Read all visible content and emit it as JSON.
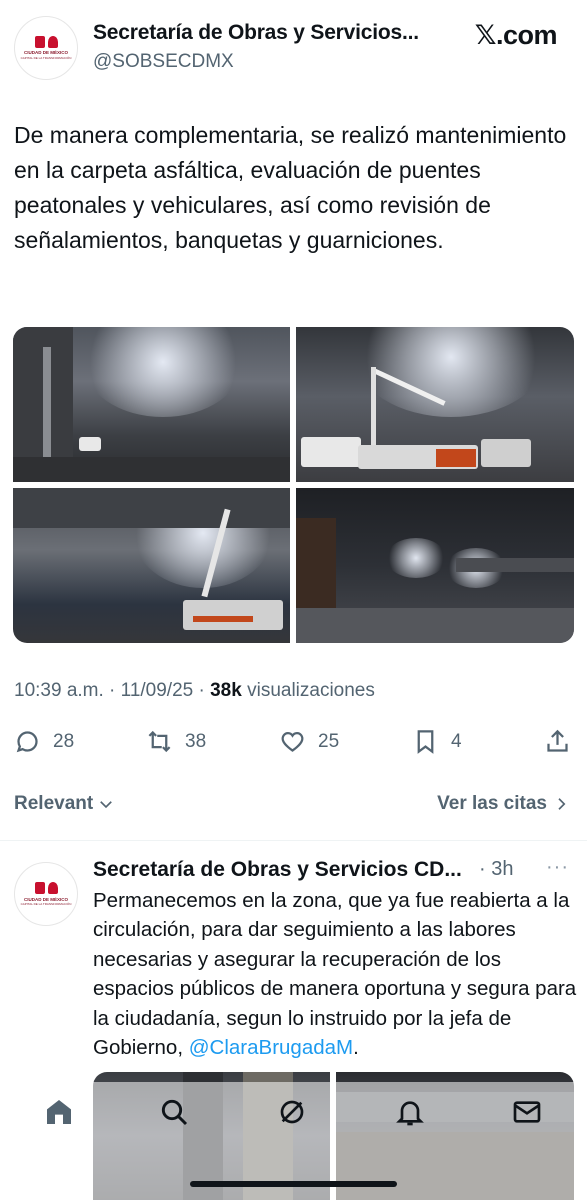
{
  "header": {
    "account_name": "Secretaría de Obras y Servicios...",
    "handle": "@SOBSECDMX",
    "site": "𝕏.com",
    "avatar_logo_text": "CIUDAD DE MÉXICO",
    "avatar_logo_sub": "CAPITAL DE LA TRANSFORMACIÓN"
  },
  "tweet": {
    "text": "De manera complementaria, se realizó mantenimiento en la carpeta asfáltica, evaluación de puentes peatonales y vehiculares, así como revisión de señalamientos, banquetas y guarniciones.",
    "time": "10:39 a.m. · 11/09/25 · ",
    "views_count": "38k",
    "views_label": " visualizaciones"
  },
  "actions": {
    "replies": "28",
    "reposts": "38",
    "likes": "25",
    "bookmarks": "4"
  },
  "filters": {
    "sort_label": "Relevant",
    "quotes_label": "Ver las citas"
  },
  "reply": {
    "account_name": "Secretaría de Obras y Servicios CD...",
    "time": "· 3h",
    "more": "···",
    "text_before": "Permanecemos en la zona, que ya fue reabierta a la circulación, para dar seguimiento a las labores necesarias y asegurar la recuperación de los espacios públicos de manera oportuna y segura para la ciudadanía, segun lo instruido por la jefa de Gobierno, ",
    "mention": "@ClaraBrugadaM",
    "text_after": "."
  },
  "nav": {
    "items": [
      "home-icon",
      "search-icon",
      "grok-icon",
      "notifications-icon",
      "messages-icon"
    ]
  },
  "colors": {
    "text_primary": "#0f1419",
    "text_secondary": "#536471",
    "link": "#1d9bf0",
    "brand_red": "#c8102e"
  }
}
